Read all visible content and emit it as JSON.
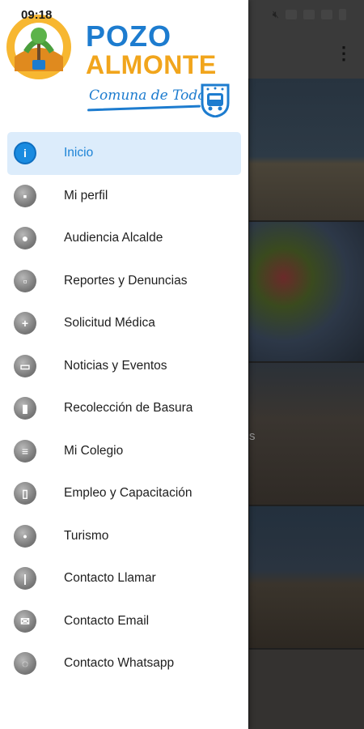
{
  "status_bar": {
    "time": "09:18"
  },
  "background_app": {
    "menu_icon": "more-vert-icon",
    "partial_text": "s"
  },
  "header": {
    "brand_line1": "POZO",
    "brand_line2": "ALMONTE",
    "tagline": "Comuna de Todos",
    "colors": {
      "blue": "#1d7ccf",
      "orange": "#f1a51c"
    }
  },
  "menu": {
    "items": [
      {
        "label": "Inicio",
        "icon": "info-icon",
        "active": true
      },
      {
        "label": "Mi perfil",
        "icon": "profile-icon",
        "active": false
      },
      {
        "label": "Audiencia Alcalde",
        "icon": "person-icon",
        "active": false
      },
      {
        "label": "Reportes y Denuncias",
        "icon": "lock-icon",
        "active": false
      },
      {
        "label": "Solicitud Médica",
        "icon": "medical-icon",
        "active": false
      },
      {
        "label": "Noticias y Eventos",
        "icon": "news-icon",
        "active": false
      },
      {
        "label": "Recolección de Basura",
        "icon": "trash-icon",
        "active": false
      },
      {
        "label": "Mi Colegio",
        "icon": "document-icon",
        "active": false
      },
      {
        "label": "Empleo y Capacitación",
        "icon": "clipboard-icon",
        "active": false
      },
      {
        "label": "Turismo",
        "icon": "pin-icon",
        "active": false
      },
      {
        "label": "Contacto Llamar",
        "icon": "phone-icon",
        "active": false
      },
      {
        "label": "Contacto Email",
        "icon": "email-icon",
        "active": false
      },
      {
        "label": "Contacto Whatsapp",
        "icon": "whatsapp-icon",
        "active": false
      }
    ]
  }
}
